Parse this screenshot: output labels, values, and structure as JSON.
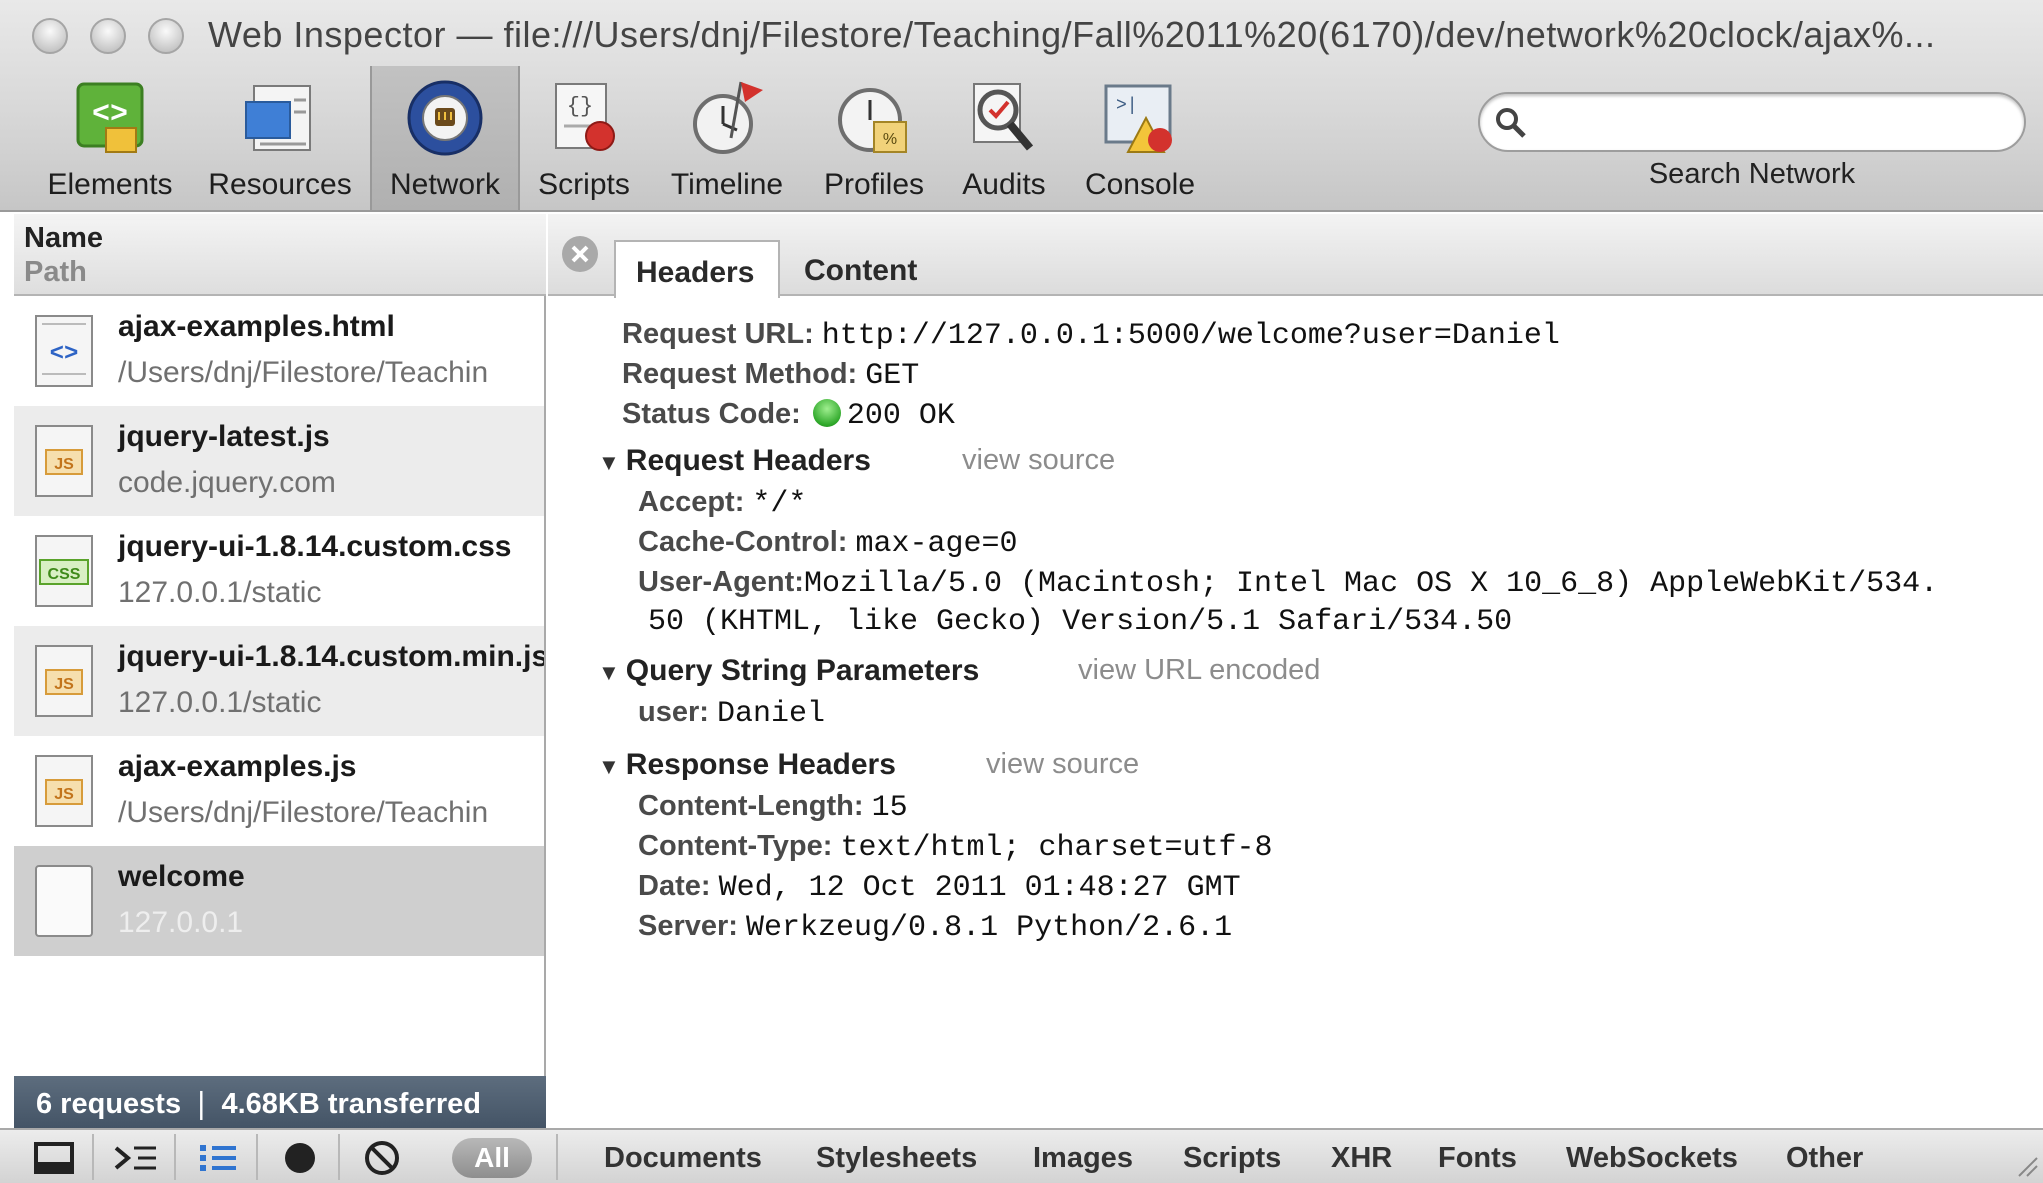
{
  "window": {
    "title": "Web Inspector — file:///Users/dnj/Filestore/Teaching/Fall%2011%20(6170)/dev/network%20clock/ajax%..."
  },
  "toolbar": {
    "items": [
      {
        "label": "Elements",
        "icon": "elements-icon"
      },
      {
        "label": "Resources",
        "icon": "resources-icon"
      },
      {
        "label": "Network",
        "icon": "network-icon",
        "selected": true
      },
      {
        "label": "Scripts",
        "icon": "scripts-icon"
      },
      {
        "label": "Timeline",
        "icon": "timeline-icon"
      },
      {
        "label": "Profiles",
        "icon": "profiles-icon"
      },
      {
        "label": "Audits",
        "icon": "audits-icon"
      },
      {
        "label": "Console",
        "icon": "console-icon"
      }
    ],
    "search": {
      "placeholder": "",
      "label": "Search Network"
    }
  },
  "requests_panel": {
    "header_name": "Name",
    "header_path": "Path",
    "rows": [
      {
        "name": "ajax-examples.html",
        "path": "/Users/dnj/Filestore/Teachin",
        "type": "html"
      },
      {
        "name": "jquery-latest.js",
        "path": "code.jquery.com",
        "type": "js"
      },
      {
        "name": "jquery-ui-1.8.14.custom.css",
        "path": "127.0.0.1/static",
        "type": "css"
      },
      {
        "name": "jquery-ui-1.8.14.custom.min.js",
        "path": "127.0.0.1/static",
        "type": "js"
      },
      {
        "name": "ajax-examples.js",
        "path": "/Users/dnj/Filestore/Teachin",
        "type": "js"
      },
      {
        "name": "welcome",
        "path": "127.0.0.1",
        "type": "blank",
        "selected": true
      }
    ],
    "summary": "6 requests  ❘  4.68KB transferred"
  },
  "detail": {
    "tabs": [
      "Headers",
      "Content"
    ],
    "active_tab": "Headers",
    "request_url_key": "Request URL:",
    "request_url": "http://127.0.0.1:5000/welcome?user=Daniel",
    "request_method_key": "Request Method:",
    "request_method": "GET",
    "status_code_key": "Status Code:",
    "status_code": "200 OK",
    "status_color": "#2fa82a",
    "request_headers": {
      "title": "Request Headers",
      "action": "view source",
      "items": [
        {
          "key": "Accept:",
          "value": "*/*"
        },
        {
          "key": "Cache-Control:",
          "value": "max-age=0"
        },
        {
          "key": "User-Agent:",
          "value": "Mozilla/5.0 (Macintosh; Intel Mac OS X 10_6_8) AppleWebKit/534.",
          "value_cont": "50 (KHTML, like Gecko) Version/5.1 Safari/534.50"
        }
      ]
    },
    "query_params": {
      "title": "Query String Parameters",
      "action": "view URL encoded",
      "items": [
        {
          "key": "user:",
          "value": "Daniel"
        }
      ]
    },
    "response_headers": {
      "title": "Response Headers",
      "action": "view source",
      "items": [
        {
          "key": "Content-Length:",
          "value": "15"
        },
        {
          "key": "Content-Type:",
          "value": "text/html; charset=utf-8"
        },
        {
          "key": "Date:",
          "value": "Wed, 12 Oct 2011 01:48:27 GMT"
        },
        {
          "key": "Server:",
          "value": "Werkzeug/0.8.1 Python/2.6.1"
        }
      ]
    }
  },
  "statusbar": {
    "buttons": [
      "dock-icon",
      "console-toggle-icon",
      "details-view-icon",
      "record-icon",
      "clear-icon"
    ],
    "all_label": "All",
    "filters": [
      "Documents",
      "Stylesheets",
      "Images",
      "Scripts",
      "XHR",
      "Fonts",
      "WebSockets",
      "Other"
    ]
  }
}
